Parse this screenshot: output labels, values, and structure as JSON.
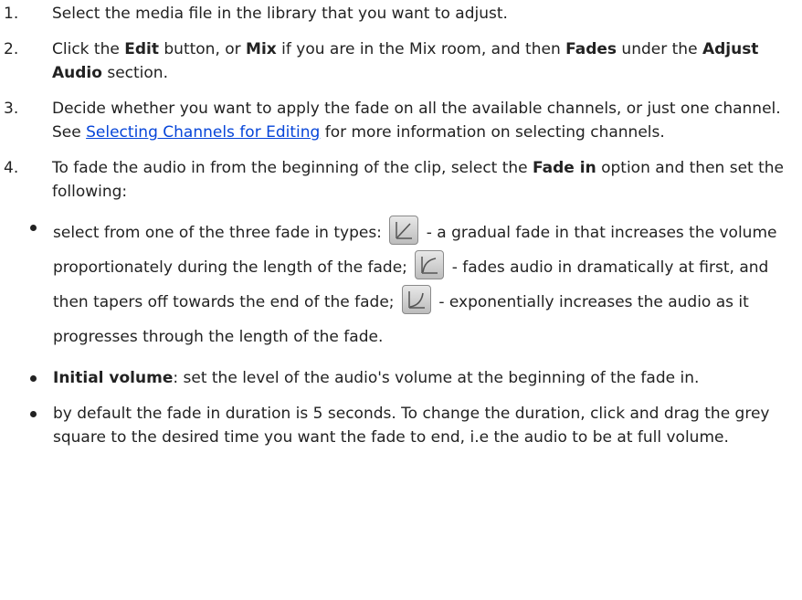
{
  "steps": [
    {
      "num": "1.",
      "text": "Select the media file in the library that you want to adjust."
    },
    {
      "num": "2.",
      "t1": "Click the ",
      "b1": "Edit",
      "t2": " button, or ",
      "b2": "Mix",
      "t3": " if you are in the Mix room, and then ",
      "b3": "Fades",
      "t4": " under the ",
      "b4": "Adjust Audio",
      "t5": " section."
    },
    {
      "num": "3.",
      "t1": "Decide whether you want to apply the fade on all the available channels, or just one channel. See ",
      "link": "Selecting Channels for Editing",
      "t2": " for more information on selecting channels."
    },
    {
      "num": "4.",
      "t1": "To fade the audio in from the beginning of the clip, select the ",
      "b1": "Fade in",
      "t2": " option and then set the following:"
    }
  ],
  "bullets": {
    "types": {
      "t1": "select from one of the three fade in types: ",
      "t2": " - a gradual fade in that increases the volume proportionately during the length of the fade; ",
      "t3": " - fades audio in dramatically at first, and then tapers off towards the end of the fade; ",
      "t4": " - exponentially increases the audio as it progresses through the length of the fade."
    },
    "initial": {
      "b": "Initial volume",
      "t": ": set the level of the audio's volume at the beginning of the fade in."
    },
    "duration": {
      "t": "by default the fade in duration is 5 seconds. To change the duration, click and drag the grey square to the desired time you want the fade to end, i.e the audio to be at full volume."
    }
  },
  "icons": [
    "fade-linear-icon",
    "fade-fast-icon",
    "fade-slow-icon"
  ]
}
